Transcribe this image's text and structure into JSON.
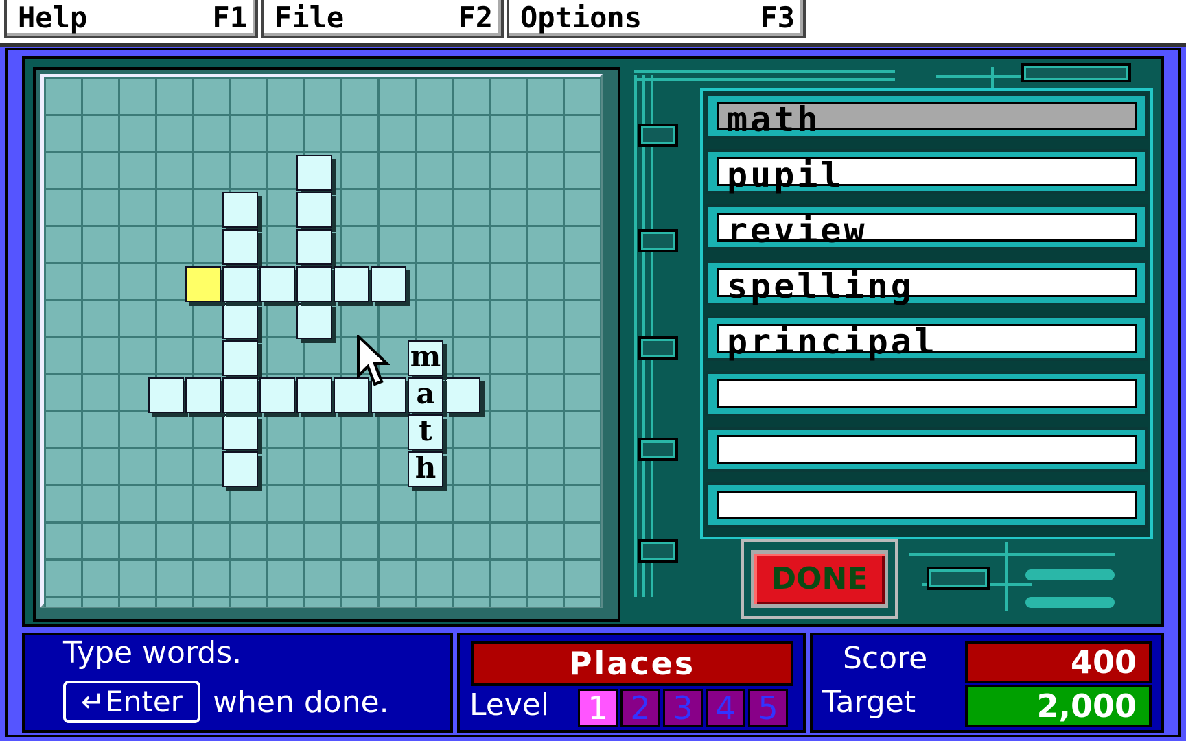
{
  "menu": [
    {
      "label": "Help",
      "key": "F1"
    },
    {
      "label": "File",
      "key": "F2"
    },
    {
      "label": "Options",
      "key": "F3"
    }
  ],
  "board": {
    "letters": [
      "m",
      "a",
      "t",
      "h"
    ]
  },
  "word_list": [
    "math",
    "pupil",
    "review",
    "spelling",
    "principal",
    "",
    "",
    ""
  ],
  "done_label": "DONE",
  "instructions": {
    "line1": "Type words.",
    "enter_key": "↵Enter",
    "line2": "when done."
  },
  "mode": "Places",
  "level": {
    "label": "Level",
    "levels": [
      "1",
      "2",
      "3",
      "4",
      "5"
    ],
    "current": "1"
  },
  "score": {
    "label": "Score",
    "value": "400"
  },
  "target": {
    "label": "Target",
    "value": "2,000"
  },
  "colors": {
    "background": "#5555ff",
    "board_grid": "#7ab9b6",
    "cell": "#d8fbfb",
    "highlight_cell": "#ffff66",
    "done_button": "#e0121e",
    "score_bg": "#b00000",
    "target_bg": "#00a000"
  }
}
